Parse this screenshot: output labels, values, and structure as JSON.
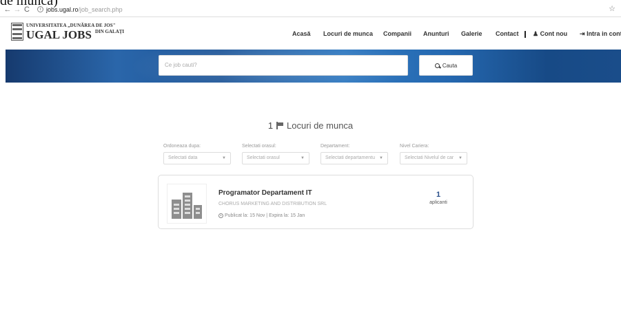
{
  "caption_fragment": "de munca)",
  "browser": {
    "url_host": "jobs.ugal.ro",
    "url_path": "/job_search.php"
  },
  "logo": {
    "university": "UNIVERSITATEA „DUNĂREA DE JOS\"",
    "name": "UGAL JOBS",
    "city": "DIN GALAȚI"
  },
  "nav": {
    "acasa": "Acasă",
    "locuri": "Locuri de munca",
    "companii": "Companii",
    "anunturi": "Anunturi",
    "galerie": "Galerie",
    "contact": "Contact",
    "cont_nou": "Cont nou",
    "intra": "Intra in cont"
  },
  "search": {
    "placeholder": "Ce job cauti?",
    "button": "Cauta"
  },
  "results": {
    "count": "1",
    "label": "Locuri de munca"
  },
  "filters": [
    {
      "label": "Ordoneaza dupa:",
      "value": "Selectati data"
    },
    {
      "label": "Selectati orasul:",
      "value": "Selectati orasul"
    },
    {
      "label": "Departament:",
      "value": "Selectati departamentu"
    },
    {
      "label": "Nivel Cariera:",
      "value": "Selectati Nivelul de car"
    }
  ],
  "job": {
    "title": "Programator Departament IT",
    "company": "CHORUS MARKETING AND DISTRIBUTION SRL",
    "dates": "Publicat la: 15 Nov | Expira la: 15 Jan",
    "applicants_count": "1",
    "applicants_label": "aplicanti"
  }
}
